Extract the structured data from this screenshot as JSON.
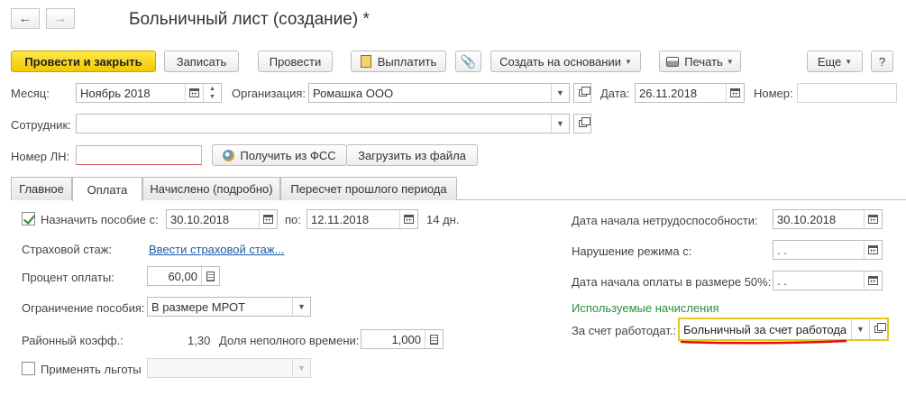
{
  "header": {
    "title": "Больничный лист (создание) *",
    "back_icon": "←",
    "forward_icon": "→"
  },
  "toolbar": {
    "post_close": "Провести и закрыть",
    "save": "Записать",
    "post": "Провести",
    "pay": "Выплатить",
    "create_based_on": "Создать на основании",
    "print": "Печать",
    "more": "Еще",
    "help": "?"
  },
  "form": {
    "month_label": "Месяц:",
    "month_value": "Ноябрь 2018",
    "org_label": "Организация:",
    "org_value": "Ромашка ООО",
    "date_label": "Дата:",
    "date_value": "26.11.2018",
    "number_label": "Номер:",
    "number_value": "",
    "employee_label": "Сотрудник:",
    "employee_value": "",
    "ln_label": "Номер ЛН:",
    "ln_value": "",
    "get_fss": "Получить из ФСС",
    "load_file": "Загрузить из файла"
  },
  "tabs": [
    "Главное",
    "Оплата",
    "Начислено (подробно)",
    "Пересчет прошлого периода"
  ],
  "payment": {
    "assign_label": "Назначить пособие с:",
    "assign_from": "30.10.2018",
    "to_label": "по:",
    "assign_to": "12.11.2018",
    "days": "14 дн.",
    "insurance_label": "Страховой стаж:",
    "insurance_link": "Ввести страховой стаж...",
    "percent_label": "Процент оплаты:",
    "percent_value": "60,00",
    "limit_label": "Ограничение пособия:",
    "limit_value": "В размере МРОТ",
    "regional_label": "Районный коэфф.:",
    "regional_value": "1,30",
    "parttime_label": "Доля неполного времени:",
    "parttime_value": "1,000",
    "benefits_label": "Применять льготы",
    "disability_start_label": "Дата начала нетрудоспособности:",
    "disability_start_value": "30.10.2018",
    "violation_label": "Нарушение режима с:",
    "violation_value": " .  .",
    "half_pay_label": "Дата начала оплаты в размере 50%:",
    "half_pay_value": " .  .",
    "accruals_header": "Используемые начисления",
    "employer_label": "За счет работодат.:",
    "employer_value": "Больничный за счет работода"
  },
  "colors": {
    "primary_button": "#f2c800",
    "link": "#1c5ba8",
    "section_green": "#2f8c3b",
    "highlight_border": "#e8c51a",
    "underline_red": "#e01010"
  }
}
